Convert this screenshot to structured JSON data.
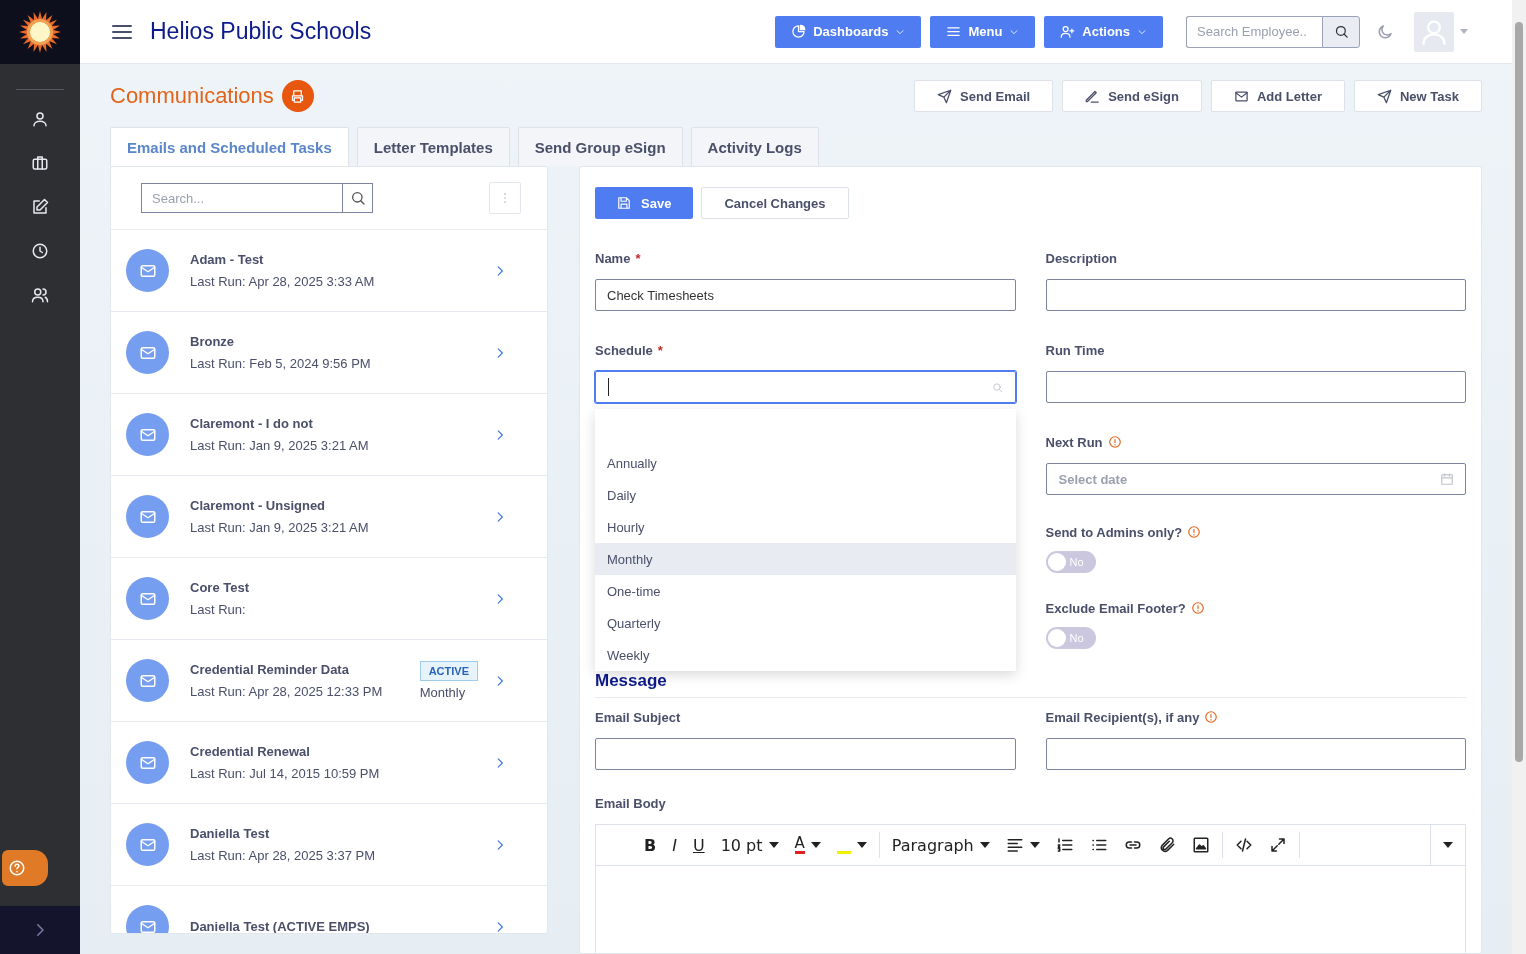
{
  "header": {
    "app_title": "Helios Public Schools",
    "nav_buttons": [
      {
        "kind": "dashboards",
        "label": "Dashboards"
      },
      {
        "kind": "menu",
        "label": "Menu"
      },
      {
        "kind": "actions",
        "label": "Actions"
      }
    ],
    "search": {
      "placeholder": "Search Employee.."
    }
  },
  "sidebar": {
    "items": [
      {
        "kind": "person"
      },
      {
        "kind": "briefcase"
      },
      {
        "kind": "edit"
      },
      {
        "kind": "clock"
      },
      {
        "kind": "people"
      }
    ]
  },
  "page": {
    "title": "Communications",
    "actions": [
      {
        "kind": "send",
        "label": "Send Email"
      },
      {
        "kind": "sign",
        "label": "Send eSign"
      },
      {
        "kind": "mail",
        "label": "Add Letter"
      },
      {
        "kind": "send",
        "label": "New Task"
      }
    ]
  },
  "tabs": [
    {
      "label": "Emails and Scheduled Tasks",
      "selected": true
    },
    {
      "label": "Letter Templates",
      "selected": false
    },
    {
      "label": "Send Group eSign",
      "selected": false
    },
    {
      "label": "Activity Logs",
      "selected": false
    }
  ],
  "task_list": {
    "search": {
      "placeholder": "Search..."
    },
    "items": [
      {
        "title": "Adam - Test",
        "last_run": "Last Run: Apr 28, 2025 3:33 AM"
      },
      {
        "title": "Bronze",
        "last_run": "Last Run: Feb 5, 2024 9:56 PM"
      },
      {
        "title": "Claremont - I do not",
        "last_run": "Last Run: Jan 9, 2025 3:21 AM"
      },
      {
        "title": "Claremont - Unsigned",
        "last_run": "Last Run: Jan 9, 2025 3:21 AM"
      },
      {
        "title": "Core Test",
        "last_run": "Last Run:"
      },
      {
        "title": "Credential Reminder Data",
        "last_run": "Last Run: Apr 28, 2025 12:33 PM",
        "badge": "ACTIVE",
        "frequency": "Monthly"
      },
      {
        "title": "Credential Renewal",
        "last_run": "Last Run: Jul 14, 2015 10:59 PM"
      },
      {
        "title": "Daniella Test",
        "last_run": "Last Run: Apr 28, 2025 3:37 PM"
      },
      {
        "title": "Daniella Test (ACTIVE EMPS)"
      }
    ]
  },
  "form": {
    "save": "Save",
    "cancel": "Cancel Changes",
    "name": {
      "label": "Name",
      "required_mark": "*",
      "value": "Check Timesheets"
    },
    "description": {
      "label": "Description"
    },
    "schedule": {
      "label": "Schedule",
      "required_mark": "*",
      "options": [
        {
          "label": "Annually",
          "selected": false
        },
        {
          "label": "Daily",
          "selected": false
        },
        {
          "label": "Hourly",
          "selected": false
        },
        {
          "label": "Monthly",
          "selected": true
        },
        {
          "label": "One-time",
          "selected": false
        },
        {
          "label": "Quarterly",
          "selected": false
        },
        {
          "label": "Weekly",
          "selected": false
        }
      ]
    },
    "run_time": {
      "label": "Run Time"
    },
    "next_run": {
      "label": "Next Run",
      "placeholder": "Select date"
    },
    "toggles": [
      {
        "label": "Send to Admins only?",
        "on": false,
        "text": "No"
      },
      {
        "label": "Exclude Email Footer?",
        "on": false,
        "text": "No"
      }
    ],
    "message_heading": "Message",
    "email_subject": {
      "label": "Email Subject"
    },
    "email_recipients": {
      "label": "Email Recipient(s), if any"
    },
    "email_body": {
      "label": "Email Body",
      "toolbar": [
        [
          {
            "kind": "bold",
            "label": "B"
          },
          {
            "kind": "italic",
            "label": "I"
          },
          {
            "kind": "underline",
            "label": "U"
          },
          {
            "kind": "fontsize",
            "label": "10 pt"
          },
          {
            "kind": "fontcolor",
            "label": "A"
          },
          {
            "kind": "highlight"
          }
        ],
        [
          {
            "kind": "blocks",
            "label": "Paragraph"
          },
          {
            "kind": "align"
          },
          {
            "kind": "ol"
          },
          {
            "kind": "ul"
          },
          {
            "kind": "link"
          },
          {
            "kind": "attach"
          },
          {
            "kind": "image"
          }
        ],
        [
          {
            "kind": "code"
          },
          {
            "kind": "fullscreen"
          }
        ],
        [
          {
            "kind": "more"
          }
        ]
      ]
    }
  }
}
